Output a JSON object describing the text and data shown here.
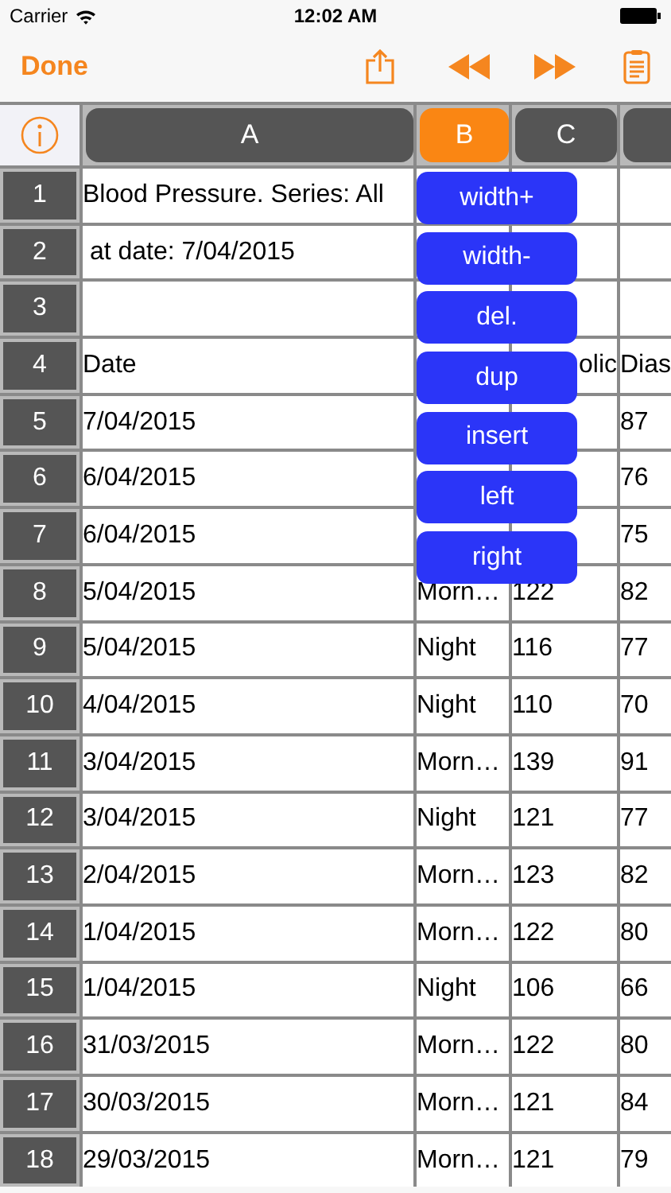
{
  "status_bar": {
    "carrier": "Carrier",
    "time": "12:02 AM"
  },
  "toolbar": {
    "done": "Done"
  },
  "columns": [
    {
      "label": "A",
      "selected": false
    },
    {
      "label": "B",
      "selected": true
    },
    {
      "label": "C",
      "selected": false
    },
    {
      "selected": false
    }
  ],
  "rows": [
    {
      "number": "1",
      "cells": [
        "Blood Pressure. Series: All",
        "",
        "",
        ""
      ]
    },
    {
      "number": "2",
      "cells": [
        " at date: 7/04/2015",
        "",
        "",
        ""
      ]
    },
    {
      "number": "3",
      "cells": [
        "",
        "",
        "",
        ""
      ]
    },
    {
      "number": "4",
      "cells": [
        "Date",
        "",
        "olic",
        "Dias"
      ],
      "partial": [
        false,
        false,
        true,
        false
      ]
    },
    {
      "number": "5",
      "cells": [
        "7/04/2015",
        "",
        "",
        "87"
      ]
    },
    {
      "number": "6",
      "cells": [
        "6/04/2015",
        "",
        "",
        "76"
      ]
    },
    {
      "number": "7",
      "cells": [
        "6/04/2015",
        "",
        "",
        "75"
      ]
    },
    {
      "number": "8",
      "cells": [
        "5/04/2015",
        "Morn…",
        "122",
        "82"
      ]
    },
    {
      "number": "9",
      "cells": [
        "5/04/2015",
        "Night",
        "116",
        "77"
      ]
    },
    {
      "number": "10",
      "cells": [
        "4/04/2015",
        "Night",
        "110",
        "70"
      ]
    },
    {
      "number": "11",
      "cells": [
        "3/04/2015",
        "Morn…",
        "139",
        "91"
      ]
    },
    {
      "number": "12",
      "cells": [
        "3/04/2015",
        "Night",
        "121",
        "77"
      ]
    },
    {
      "number": "13",
      "cells": [
        "2/04/2015",
        "Morn…",
        "123",
        "82"
      ]
    },
    {
      "number": "14",
      "cells": [
        "1/04/2015",
        "Morn…",
        "122",
        "80"
      ]
    },
    {
      "number": "15",
      "cells": [
        "1/04/2015",
        "Night",
        "106",
        "66"
      ]
    },
    {
      "number": "16",
      "cells": [
        "31/03/2015",
        "Morn…",
        "122",
        "80"
      ]
    },
    {
      "number": "17",
      "cells": [
        "30/03/2015",
        "Morn…",
        "121",
        "84"
      ]
    },
    {
      "number": "18",
      "cells": [
        "29/03/2015",
        "Morn…",
        "121",
        "79"
      ]
    }
  ],
  "column_menu": [
    "width+",
    "width-",
    "del.",
    "dup",
    "insert",
    "left",
    "right"
  ]
}
